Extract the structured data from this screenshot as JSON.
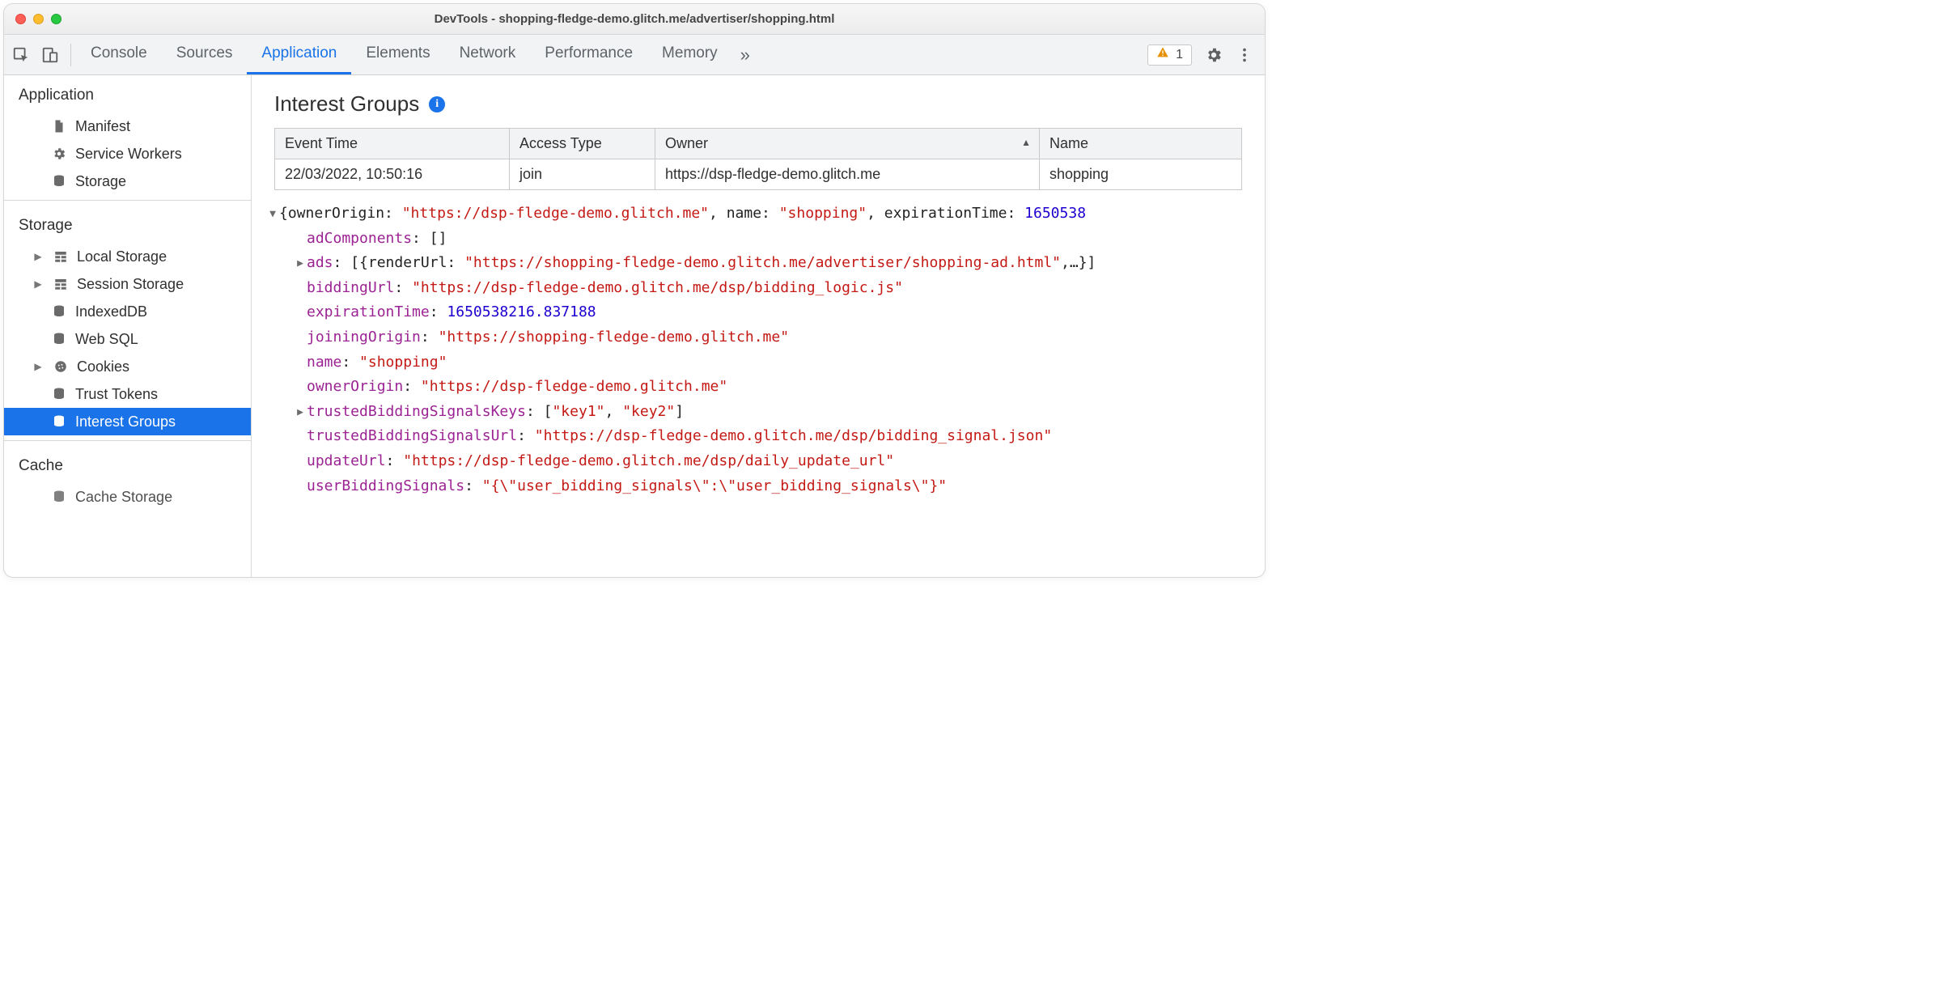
{
  "window_title": "DevTools - shopping-fledge-demo.glitch.me/advertiser/shopping.html",
  "tabs": [
    "Console",
    "Sources",
    "Application",
    "Elements",
    "Network",
    "Performance",
    "Memory"
  ],
  "active_tab": "Application",
  "warning_count": "1",
  "sidebar": {
    "sections": [
      {
        "title": "Application",
        "items": [
          {
            "label": "Manifest",
            "icon": "file"
          },
          {
            "label": "Service Workers",
            "icon": "gear"
          },
          {
            "label": "Storage",
            "icon": "db"
          }
        ]
      },
      {
        "title": "Storage",
        "items": [
          {
            "label": "Local Storage",
            "icon": "grid",
            "caret": true
          },
          {
            "label": "Session Storage",
            "icon": "grid",
            "caret": true
          },
          {
            "label": "IndexedDB",
            "icon": "db"
          },
          {
            "label": "Web SQL",
            "icon": "db"
          },
          {
            "label": "Cookies",
            "icon": "cookie",
            "caret": true
          },
          {
            "label": "Trust Tokens",
            "icon": "db"
          },
          {
            "label": "Interest Groups",
            "icon": "db",
            "selected": true
          }
        ]
      },
      {
        "title": "Cache",
        "items": [
          {
            "label": "Cache Storage",
            "icon": "db"
          }
        ]
      }
    ]
  },
  "panel_title": "Interest Groups",
  "columns": [
    "Event Time",
    "Access Type",
    "Owner",
    "Name"
  ],
  "sorted_col": "Owner",
  "rows": [
    {
      "event_time": "22/03/2022, 10:50:16",
      "access_type": "join",
      "owner": "https://dsp-fledge-demo.glitch.me",
      "name": "shopping"
    }
  ],
  "detail": {
    "summary_prefix": "{ownerOrigin: ",
    "summary_owner": "\"https://dsp-fledge-demo.glitch.me\"",
    "summary_mid1": ", name: ",
    "summary_name": "\"shopping\"",
    "summary_mid2": ", expirationTime: ",
    "summary_exp": "1650538",
    "adComponents_key": "adComponents",
    "adComponents_val": "[]",
    "ads_key": "ads",
    "ads_val_prefix": "[{renderUrl: ",
    "ads_val_str": "\"https://shopping-fledge-demo.glitch.me/advertiser/shopping-ad.html\"",
    "ads_val_suffix": ",…}]",
    "biddingUrl_key": "biddingUrl",
    "biddingUrl_val": "\"https://dsp-fledge-demo.glitch.me/dsp/bidding_logic.js\"",
    "expirationTime_key": "expirationTime",
    "expirationTime_val": "1650538216.837188",
    "joiningOrigin_key": "joiningOrigin",
    "joiningOrigin_val": "\"https://shopping-fledge-demo.glitch.me\"",
    "name_key": "name",
    "name_val": "\"shopping\"",
    "ownerOrigin_key": "ownerOrigin",
    "ownerOrigin_val": "\"https://dsp-fledge-demo.glitch.me\"",
    "tbsk_key": "trustedBiddingSignalsKeys",
    "tbsk_val_prefix": "[",
    "tbsk_val_k1": "\"key1\"",
    "tbsk_val_sep": ", ",
    "tbsk_val_k2": "\"key2\"",
    "tbsk_val_suffix": "]",
    "tbsu_key": "trustedBiddingSignalsUrl",
    "tbsu_val": "\"https://dsp-fledge-demo.glitch.me/dsp/bidding_signal.json\"",
    "updateUrl_key": "updateUrl",
    "updateUrl_val": "\"https://dsp-fledge-demo.glitch.me/dsp/daily_update_url\"",
    "ubs_key": "userBiddingSignals",
    "ubs_val": "\"{\\\"user_bidding_signals\\\":\\\"user_bidding_signals\\\"}\""
  }
}
